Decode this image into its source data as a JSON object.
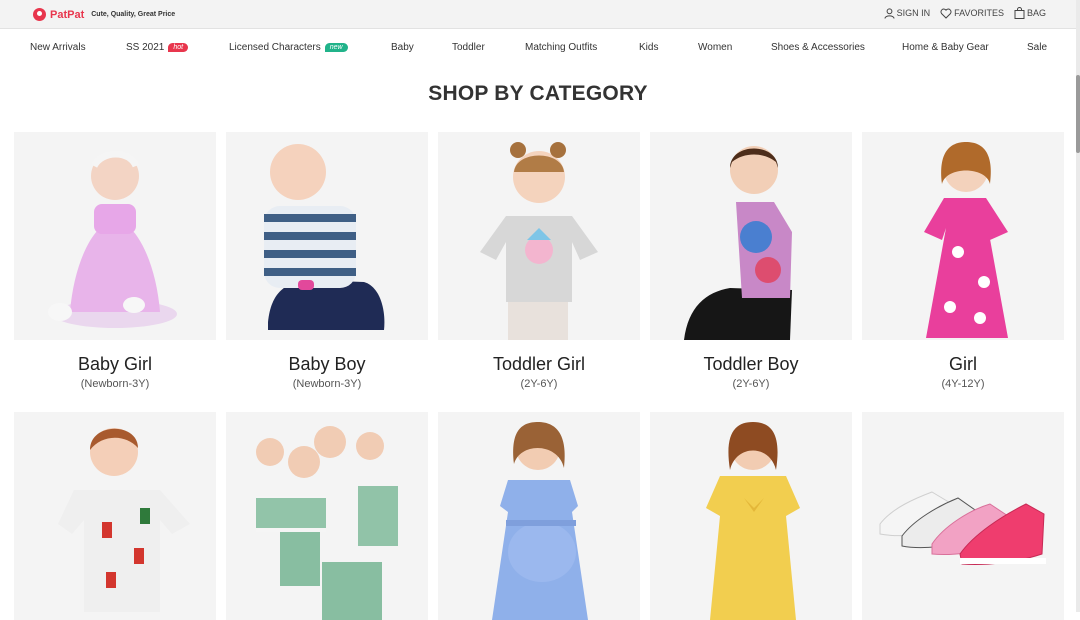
{
  "header": {
    "logo_text": "PatPat",
    "tagline": "Cute, Quality, Great Price",
    "sign_in": "SIGN IN",
    "favorites": "FAVORITES",
    "bag": "BAG"
  },
  "nav": {
    "items": [
      {
        "label": "New Arrivals"
      },
      {
        "label": "SS 2021",
        "badge": "hot"
      },
      {
        "label": "Licensed Characters",
        "badge": "new"
      },
      {
        "label": "Baby"
      },
      {
        "label": "Toddler"
      },
      {
        "label": "Matching Outfits"
      },
      {
        "label": "Kids"
      },
      {
        "label": "Women"
      },
      {
        "label": "Shoes & Accessories"
      },
      {
        "label": "Home & Baby Gear"
      },
      {
        "label": "Sale"
      }
    ]
  },
  "section": {
    "title": "SHOP BY CATEGORY"
  },
  "categories": [
    {
      "name": "Baby Girl",
      "range": "(Newborn-3Y)",
      "icon": "baby-girl-photo"
    },
    {
      "name": "Baby Boy",
      "range": "(Newborn-3Y)",
      "icon": "baby-boy-photo"
    },
    {
      "name": "Toddler Girl",
      "range": "(2Y-6Y)",
      "icon": "toddler-girl-photo"
    },
    {
      "name": "Toddler Boy",
      "range": "(2Y-6Y)",
      "icon": "toddler-boy-photo"
    },
    {
      "name": "Girl",
      "range": "(4Y-12Y)",
      "icon": "girl-photo"
    },
    {
      "icon": "boy-photo"
    },
    {
      "icon": "family-matching-photo"
    },
    {
      "icon": "maternity-photo"
    },
    {
      "icon": "women-photo"
    },
    {
      "icon": "shoes-photo"
    }
  ],
  "colors": {
    "brand": "#e8364d",
    "hot": "#e8364d",
    "new": "#21b38a",
    "card_bg": "#f4f4f4"
  }
}
